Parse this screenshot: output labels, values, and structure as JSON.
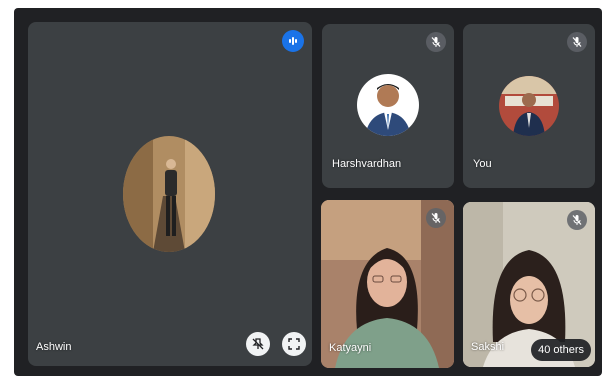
{
  "participants": {
    "ashwin": {
      "name": "Ashwin"
    },
    "harshvardhan": {
      "name": "Harshvardhan"
    },
    "you": {
      "name": "You"
    },
    "katyayni": {
      "name": "Katyayni"
    },
    "sakshi": {
      "name": "Sakshi"
    }
  },
  "overflow": {
    "label": "40 others"
  },
  "icons": {
    "speaking": "audio-level-icon",
    "muted": "mic-off-icon",
    "pin": "pin-off-icon",
    "fullscreen": "fullscreen-icon"
  },
  "colors": {
    "background": "#202124",
    "tile": "#3c4043",
    "accent": "#1a73e8"
  }
}
